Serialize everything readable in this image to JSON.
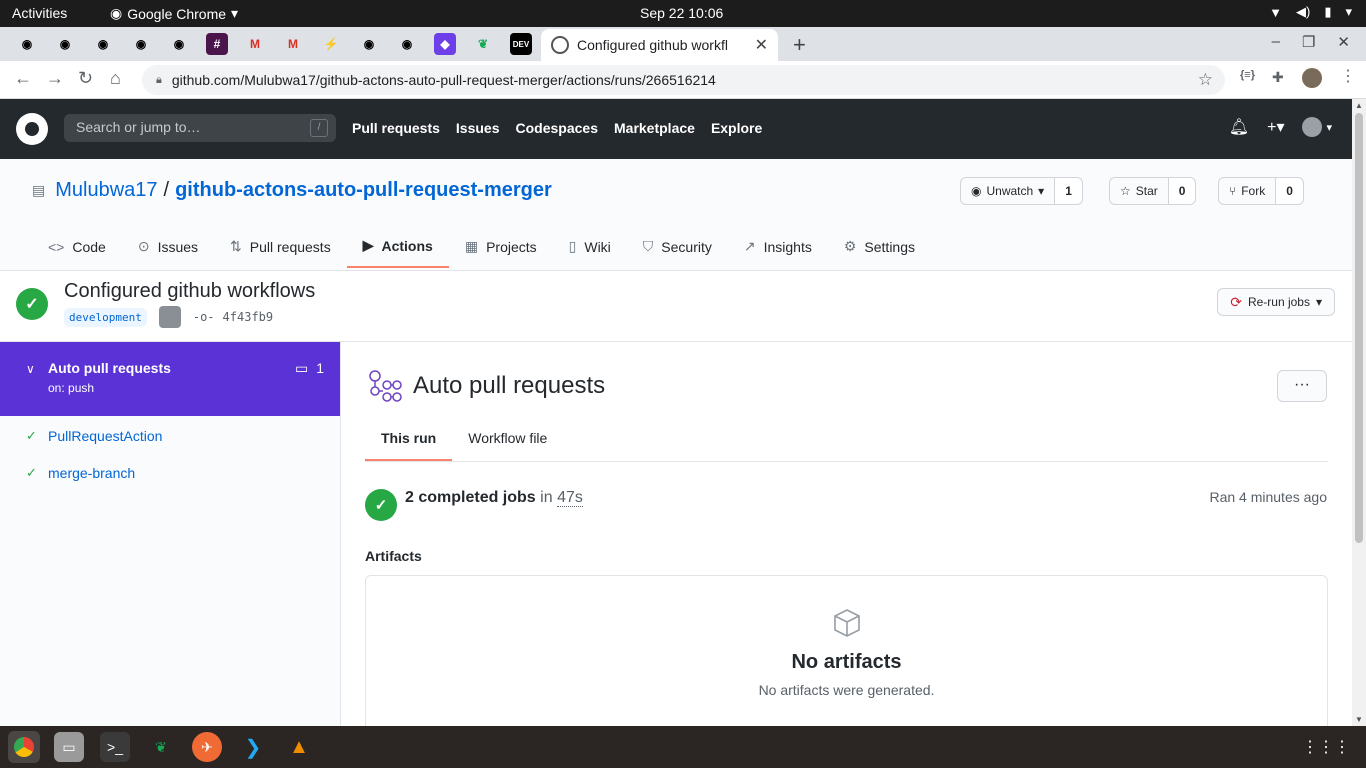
{
  "system": {
    "activities": "Activities",
    "app_name": "Google Chrome",
    "clock": "Sep 22  10:06"
  },
  "browser": {
    "active_tab_title": "Configured github workfl",
    "url": "github.com/Mulubwa17/github-actons-auto-pull-request-merger/actions/runs/266516214",
    "extension_label": "{≡}"
  },
  "github_header": {
    "search_placeholder": "Search or jump to…",
    "search_shortcut": "/",
    "nav": [
      "Pull requests",
      "Issues",
      "Codespaces",
      "Marketplace",
      "Explore"
    ]
  },
  "repo": {
    "owner": "Mulubwa17",
    "separator": "/",
    "name": "github-actons-auto-pull-request-merger",
    "watch_label": "Unwatch",
    "watch_count": "1",
    "star_label": "Star",
    "star_count": "0",
    "fork_label": "Fork",
    "fork_count": "0",
    "tabs": [
      "Code",
      "Issues",
      "Pull requests",
      "Actions",
      "Projects",
      "Wiki",
      "Security",
      "Insights",
      "Settings"
    ]
  },
  "run": {
    "title": "Configured github workflows",
    "branch": "development",
    "commit_sha": "4f43fb9",
    "rerun_label": "Re-run jobs"
  },
  "sidebar": {
    "workflow_name": "Auto pull requests",
    "trigger": "on: push",
    "comment_count": "1",
    "jobs": [
      "PullRequestAction",
      "merge-branch"
    ]
  },
  "main": {
    "title": "Auto pull requests",
    "kebab": "···",
    "tabs": [
      "This run",
      "Workflow file"
    ],
    "jobs_completed": "2 completed jobs",
    "in_word": "in",
    "duration": "47s",
    "ran": "Ran 4 minutes ago",
    "artifacts_label": "Artifacts",
    "no_artifacts_title": "No artifacts",
    "no_artifacts_text": "No artifacts were generated."
  },
  "colors": {
    "github_header": "#24292e",
    "accent_purple": "#5a32d5",
    "success_green": "#28a745",
    "link_blue": "#0366d6",
    "tab_underline": "#f9826c"
  }
}
